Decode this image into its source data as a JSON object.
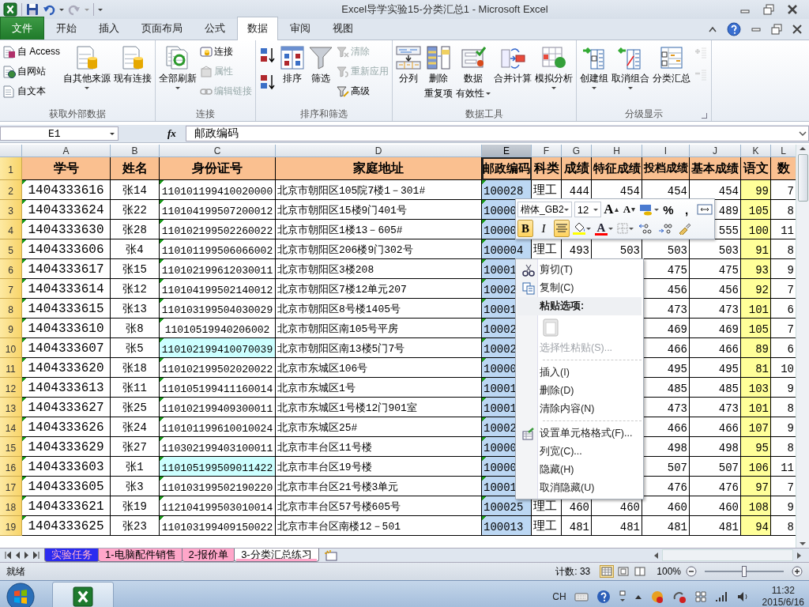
{
  "title_bar": {
    "title": "Excel导学实验15-分类汇总1 - Microsoft Excel"
  },
  "ribbon": {
    "tabs": [
      {
        "label": "文件",
        "kind": "file",
        "selected": false
      },
      {
        "label": "开始",
        "kind": "tab",
        "selected": false
      },
      {
        "label": "插入",
        "kind": "tab",
        "selected": false
      },
      {
        "label": "页面布局",
        "kind": "tab",
        "selected": false
      },
      {
        "label": "公式",
        "kind": "tab",
        "selected": false
      },
      {
        "label": "数据",
        "kind": "tab",
        "selected": true
      },
      {
        "label": "审阅",
        "kind": "tab",
        "selected": false
      },
      {
        "label": "视图",
        "kind": "tab",
        "selected": false
      }
    ],
    "groups": [
      {
        "title": "获取外部数据",
        "launcher": false,
        "columns": [
          [
            {
              "kind": "small",
              "label": "自 Access",
              "disabled": false
            },
            {
              "kind": "small",
              "label": "自网站",
              "disabled": false
            },
            {
              "kind": "small",
              "label": "自文本",
              "disabled": false
            }
          ],
          [
            {
              "kind": "large",
              "lines": [
                "自其他来源"
              ],
              "dropdown": true,
              "disabled": false
            }
          ],
          [
            {
              "kind": "large",
              "lines": [
                "现有连接"
              ],
              "dropdown": false,
              "disabled": false
            }
          ]
        ]
      },
      {
        "title": "连接",
        "launcher": false,
        "columns": [
          [
            {
              "kind": "large",
              "lines": [
                "全部刷新"
              ],
              "dropdown": true,
              "disabled": false
            }
          ],
          [
            {
              "kind": "small",
              "label": "连接",
              "disabled": false
            },
            {
              "kind": "small",
              "label": "属性",
              "disabled": true
            },
            {
              "kind": "small",
              "label": "编辑链接",
              "disabled": true
            }
          ]
        ]
      },
      {
        "title": "排序和筛选",
        "launcher": false,
        "columns": [
          [
            {
              "kind": "icon",
              "disabled": false
            },
            {
              "kind": "icon",
              "disabled": false
            }
          ],
          [
            {
              "kind": "large",
              "lines": [
                "排序"
              ],
              "dropdown": false,
              "disabled": false
            }
          ],
          [
            {
              "kind": "large",
              "lines": [
                "筛选"
              ],
              "dropdown": false,
              "disabled": false
            }
          ],
          [
            {
              "kind": "small",
              "label": "清除",
              "disabled": true
            },
            {
              "kind": "small",
              "label": "重新应用",
              "disabled": true
            },
            {
              "kind": "small",
              "label": "高级",
              "disabled": false
            }
          ]
        ]
      },
      {
        "title": "数据工具",
        "launcher": false,
        "columns": [
          [
            {
              "kind": "large",
              "lines": [
                "分列"
              ],
              "dropdown": false,
              "disabled": false
            }
          ],
          [
            {
              "kind": "large",
              "lines": [
                "删除",
                "重复项"
              ],
              "dropdown": false,
              "disabled": false
            }
          ],
          [
            {
              "kind": "large",
              "lines": [
                "数据",
                "有效性"
              ],
              "dropdown": true,
              "disabled": false
            }
          ],
          [
            {
              "kind": "large",
              "lines": [
                "合并计算"
              ],
              "dropdown": false,
              "disabled": false
            }
          ],
          [
            {
              "kind": "large",
              "lines": [
                "模拟分析"
              ],
              "dropdown": true,
              "disabled": false
            }
          ]
        ]
      },
      {
        "title": "分级显示",
        "launcher": true,
        "columns": [
          [
            {
              "kind": "large",
              "lines": [
                "创建组"
              ],
              "dropdown": true,
              "disabled": false
            }
          ],
          [
            {
              "kind": "large",
              "lines": [
                "取消组合"
              ],
              "dropdown": true,
              "disabled": false
            }
          ],
          [
            {
              "kind": "large",
              "lines": [
                "分类汇总"
              ],
              "dropdown": false,
              "disabled": false
            }
          ],
          [
            {
              "kind": "icon",
              "disabled": true
            },
            {
              "kind": "icon",
              "disabled": true
            }
          ]
        ]
      }
    ]
  },
  "formula_bar": {
    "name_box": "E1",
    "fx": "fx",
    "formula": "邮政编码"
  },
  "sheet": {
    "columns": [
      {
        "label": "A",
        "selected": false
      },
      {
        "label": "B",
        "selected": false
      },
      {
        "label": "C",
        "selected": false
      },
      {
        "label": "D",
        "selected": false
      },
      {
        "label": "E",
        "selected": true
      },
      {
        "label": "F",
        "selected": false
      },
      {
        "label": "G",
        "selected": false
      },
      {
        "label": "H",
        "selected": false
      },
      {
        "label": "I",
        "selected": false
      },
      {
        "label": "J",
        "selected": false
      },
      {
        "label": "K",
        "selected": false
      },
      {
        "label": "L",
        "selected": false
      }
    ],
    "header_row": {
      "number": "1",
      "cells": [
        "学号",
        "姓名",
        "身份证号",
        "家庭地址",
        "邮政编码",
        "科类",
        "成绩",
        "特征成绩",
        "投档成绩",
        "基本成绩",
        "语文",
        "数"
      ]
    },
    "rows": [
      {
        "number": "2",
        "id_highlighted": false,
        "cells": {
          "a": "1404333616",
          "b": "张14",
          "c": "110101199410020000",
          "d": "北京市朝阳区105院7楼1－301#",
          "e": "100028",
          "f": "理工",
          "g": "444",
          "h": "454",
          "i": "454",
          "j": "454",
          "k": "99",
          "l": "7"
        }
      },
      {
        "number": "3",
        "id_highlighted": false,
        "cells": {
          "a": "1404333624",
          "b": "张22",
          "c": "110104199507200012",
          "d": "北京市朝阳区15楼9门401号",
          "e": "10000",
          "j": "489",
          "k": "105",
          "l": "8"
        }
      },
      {
        "number": "4",
        "id_highlighted": false,
        "cells": {
          "a": "1404333630",
          "b": "张28",
          "c": "110102199502260022",
          "d": "北京市朝阳区1楼13－605#",
          "e": "10000",
          "j": "555",
          "k": "100",
          "l": "11"
        }
      },
      {
        "number": "5",
        "id_highlighted": false,
        "cells": {
          "a": "1404333606",
          "b": "张4",
          "c": "110101199506066002",
          "d": "北京市朝阳区206楼9门302号",
          "e": "100004",
          "f": "理工",
          "g": "493",
          "h": "503",
          "i": "503",
          "j": "503",
          "k": "91",
          "l": "8"
        }
      },
      {
        "number": "6",
        "id_highlighted": false,
        "cells": {
          "a": "1404333617",
          "b": "张15",
          "c": "110102199612030011",
          "d": "北京市朝阳区3楼208",
          "e": "10001",
          "i": "475",
          "j": "475",
          "k": "93",
          "l": "9"
        }
      },
      {
        "number": "7",
        "id_highlighted": false,
        "cells": {
          "a": "1404333614",
          "b": "张12",
          "c": "110104199502140012",
          "d": "北京市朝阳区7楼12单元207",
          "e": "10002",
          "i": "456",
          "j": "456",
          "k": "92",
          "l": "7"
        }
      },
      {
        "number": "8",
        "id_highlighted": false,
        "cells": {
          "a": "1404333615",
          "b": "张13",
          "c": "110103199504030029",
          "d": "北京市朝阳区8号楼1405号",
          "e": "10001",
          "i": "473",
          "j": "473",
          "k": "101",
          "l": "6"
        }
      },
      {
        "number": "9",
        "id_highlighted": false,
        "cells": {
          "a": "1404333610",
          "b": "张8",
          "c": "11010519940206002",
          "d": "北京市朝阳区南105号平房",
          "e": "10002",
          "i": "469",
          "j": "469",
          "k": "105",
          "l": "7"
        }
      },
      {
        "number": "10",
        "id_highlighted": true,
        "cells": {
          "a": "1404333607",
          "b": "张5",
          "c": "110102199410070039",
          "d": "北京市朝阳区南13楼5门7号",
          "e": "10002",
          "i": "466",
          "j": "466",
          "k": "89",
          "l": "6"
        }
      },
      {
        "number": "11",
        "id_highlighted": false,
        "cells": {
          "a": "1404333620",
          "b": "张18",
          "c": "110102199502020022",
          "d": "北京市东城区106号",
          "e": "10000",
          "i": "495",
          "j": "495",
          "k": "81",
          "l": "10"
        }
      },
      {
        "number": "12",
        "id_highlighted": false,
        "cells": {
          "a": "1404333613",
          "b": "张11",
          "c": "110105199411160014",
          "d": "北京市东城区1号",
          "e": "10001",
          "i": "485",
          "j": "485",
          "k": "103",
          "l": "9"
        }
      },
      {
        "number": "13",
        "id_highlighted": false,
        "cells": {
          "a": "1404333627",
          "b": "张25",
          "c": "110102199409300011",
          "d": "北京市东城区1号楼12门901室",
          "e": "10001",
          "i": "473",
          "j": "473",
          "k": "101",
          "l": "8"
        }
      },
      {
        "number": "14",
        "id_highlighted": false,
        "cells": {
          "a": "1404333626",
          "b": "张24",
          "c": "110101199610010024",
          "d": "北京市东城区25#",
          "e": "10002",
          "i": "466",
          "j": "466",
          "k": "107",
          "l": "9"
        }
      },
      {
        "number": "15",
        "id_highlighted": false,
        "cells": {
          "a": "1404333629",
          "b": "张27",
          "c": "110302199403100011",
          "d": "北京市丰台区11号楼",
          "e": "10000",
          "i": "498",
          "j": "498",
          "k": "95",
          "l": "8"
        }
      },
      {
        "number": "16",
        "id_highlighted": true,
        "cells": {
          "a": "1404333603",
          "b": "张1",
          "c": "110105199509011422",
          "d": "北京市丰台区19号楼",
          "e": "10000",
          "i": "507",
          "j": "507",
          "k": "106",
          "l": "11"
        }
      },
      {
        "number": "17",
        "id_highlighted": false,
        "cells": {
          "a": "1404333605",
          "b": "张3",
          "c": "110103199502190220",
          "d": "北京市丰台区21号楼3单元",
          "e": "10001",
          "i": "476",
          "j": "476",
          "k": "97",
          "l": "7"
        }
      },
      {
        "number": "18",
        "id_highlighted": false,
        "cells": {
          "a": "1404333621",
          "b": "张19",
          "c": "112104199503010014",
          "d": "北京市丰台区57号楼605号",
          "e": "100025",
          "f": "理工",
          "g": "460",
          "h": "460",
          "i": "460",
          "j": "460",
          "k": "108",
          "l": "9"
        }
      },
      {
        "number": "19",
        "id_highlighted": false,
        "cells": {
          "a": "1404333625",
          "b": "张23",
          "c": "110103199409150022",
          "d": "北京市丰台区南楼12－501",
          "e": "100013",
          "f": "理工",
          "g": "481",
          "h": "481",
          "i": "481",
          "j": "481",
          "k": "94",
          "l": "8"
        }
      }
    ]
  },
  "mini_toolbar": {
    "font": "楷体_GB2",
    "size": "12",
    "rows": [
      [
        {
          "kind": "grow-font",
          "label": "A",
          "pressed": false,
          "dropdown": false
        },
        {
          "kind": "shrink-font",
          "label": "A",
          "pressed": false,
          "dropdown": false
        },
        {
          "kind": "accounting",
          "pressed": false,
          "dropdown": true
        },
        {
          "kind": "glyph",
          "label": "%",
          "pressed": false,
          "dropdown": false
        },
        {
          "kind": "glyph",
          "label": ",",
          "pressed": false,
          "dropdown": false
        },
        {
          "kind": "merge",
          "pressed": false,
          "dropdown": false
        }
      ],
      [
        {
          "kind": "bold",
          "label": "B",
          "pressed": true,
          "dropdown": false
        },
        {
          "kind": "italic",
          "label": "I",
          "pressed": false,
          "dropdown": false
        },
        {
          "kind": "center",
          "pressed": true,
          "dropdown": false
        },
        {
          "kind": "fill-color",
          "color": "#ffff00",
          "pressed": false,
          "dropdown": true
        },
        {
          "kind": "font-color",
          "label": "A",
          "color": "#ff0000",
          "pressed": false,
          "dropdown": true
        },
        {
          "kind": "borders",
          "pressed": false,
          "dropdown": true
        },
        {
          "kind": "increase-decimal",
          "pressed": false,
          "dropdown": false
        },
        {
          "kind": "decrease-decimal",
          "pressed": false,
          "dropdown": false
        },
        {
          "kind": "painter",
          "pressed": false,
          "dropdown": false
        }
      ]
    ]
  },
  "context_menu": [
    {
      "kind": "item",
      "label": "剪切(T)",
      "disabled": false
    },
    {
      "kind": "item",
      "label": "复制(C)",
      "disabled": false
    },
    {
      "kind": "header",
      "label": "粘贴选项:"
    },
    {
      "kind": "paste-icon",
      "disabled": true
    },
    {
      "kind": "item",
      "label": "选择性粘贴(S)...",
      "disabled": true
    },
    {
      "kind": "separator"
    },
    {
      "kind": "item",
      "label": "插入(I)",
      "disabled": false
    },
    {
      "kind": "item",
      "label": "删除(D)",
      "disabled": false
    },
    {
      "kind": "item",
      "label": "清除内容(N)",
      "disabled": false
    },
    {
      "kind": "separator"
    },
    {
      "kind": "item",
      "label": "设置单元格格式(F)...",
      "disabled": false
    },
    {
      "kind": "item",
      "label": "列宽(C)...",
      "disabled": false
    },
    {
      "kind": "item",
      "label": "隐藏(H)",
      "disabled": false
    },
    {
      "kind": "item",
      "label": "取消隐藏(U)",
      "disabled": false
    }
  ],
  "sheet_tabs": [
    {
      "label": "实验任务",
      "color": "#2b2bf0",
      "selected": false
    },
    {
      "label": "1-电脑配件销售",
      "color": "#ffa6c9",
      "selected": false
    },
    {
      "label": "2-报价单",
      "color": "#ffa6c9",
      "selected": false
    },
    {
      "label": "3-分类汇总练习",
      "color": "#ffa6c9",
      "selected": true
    }
  ],
  "status_bar": {
    "status": "就绪",
    "count": "计数: 33",
    "views": [
      {
        "selected": true
      },
      {
        "selected": false
      },
      {
        "selected": false
      }
    ],
    "zoom": "100%",
    "level": 0.5
  },
  "taskbar": {
    "ime": "CH",
    "time": "11:32",
    "date": "2015/6/16"
  }
}
